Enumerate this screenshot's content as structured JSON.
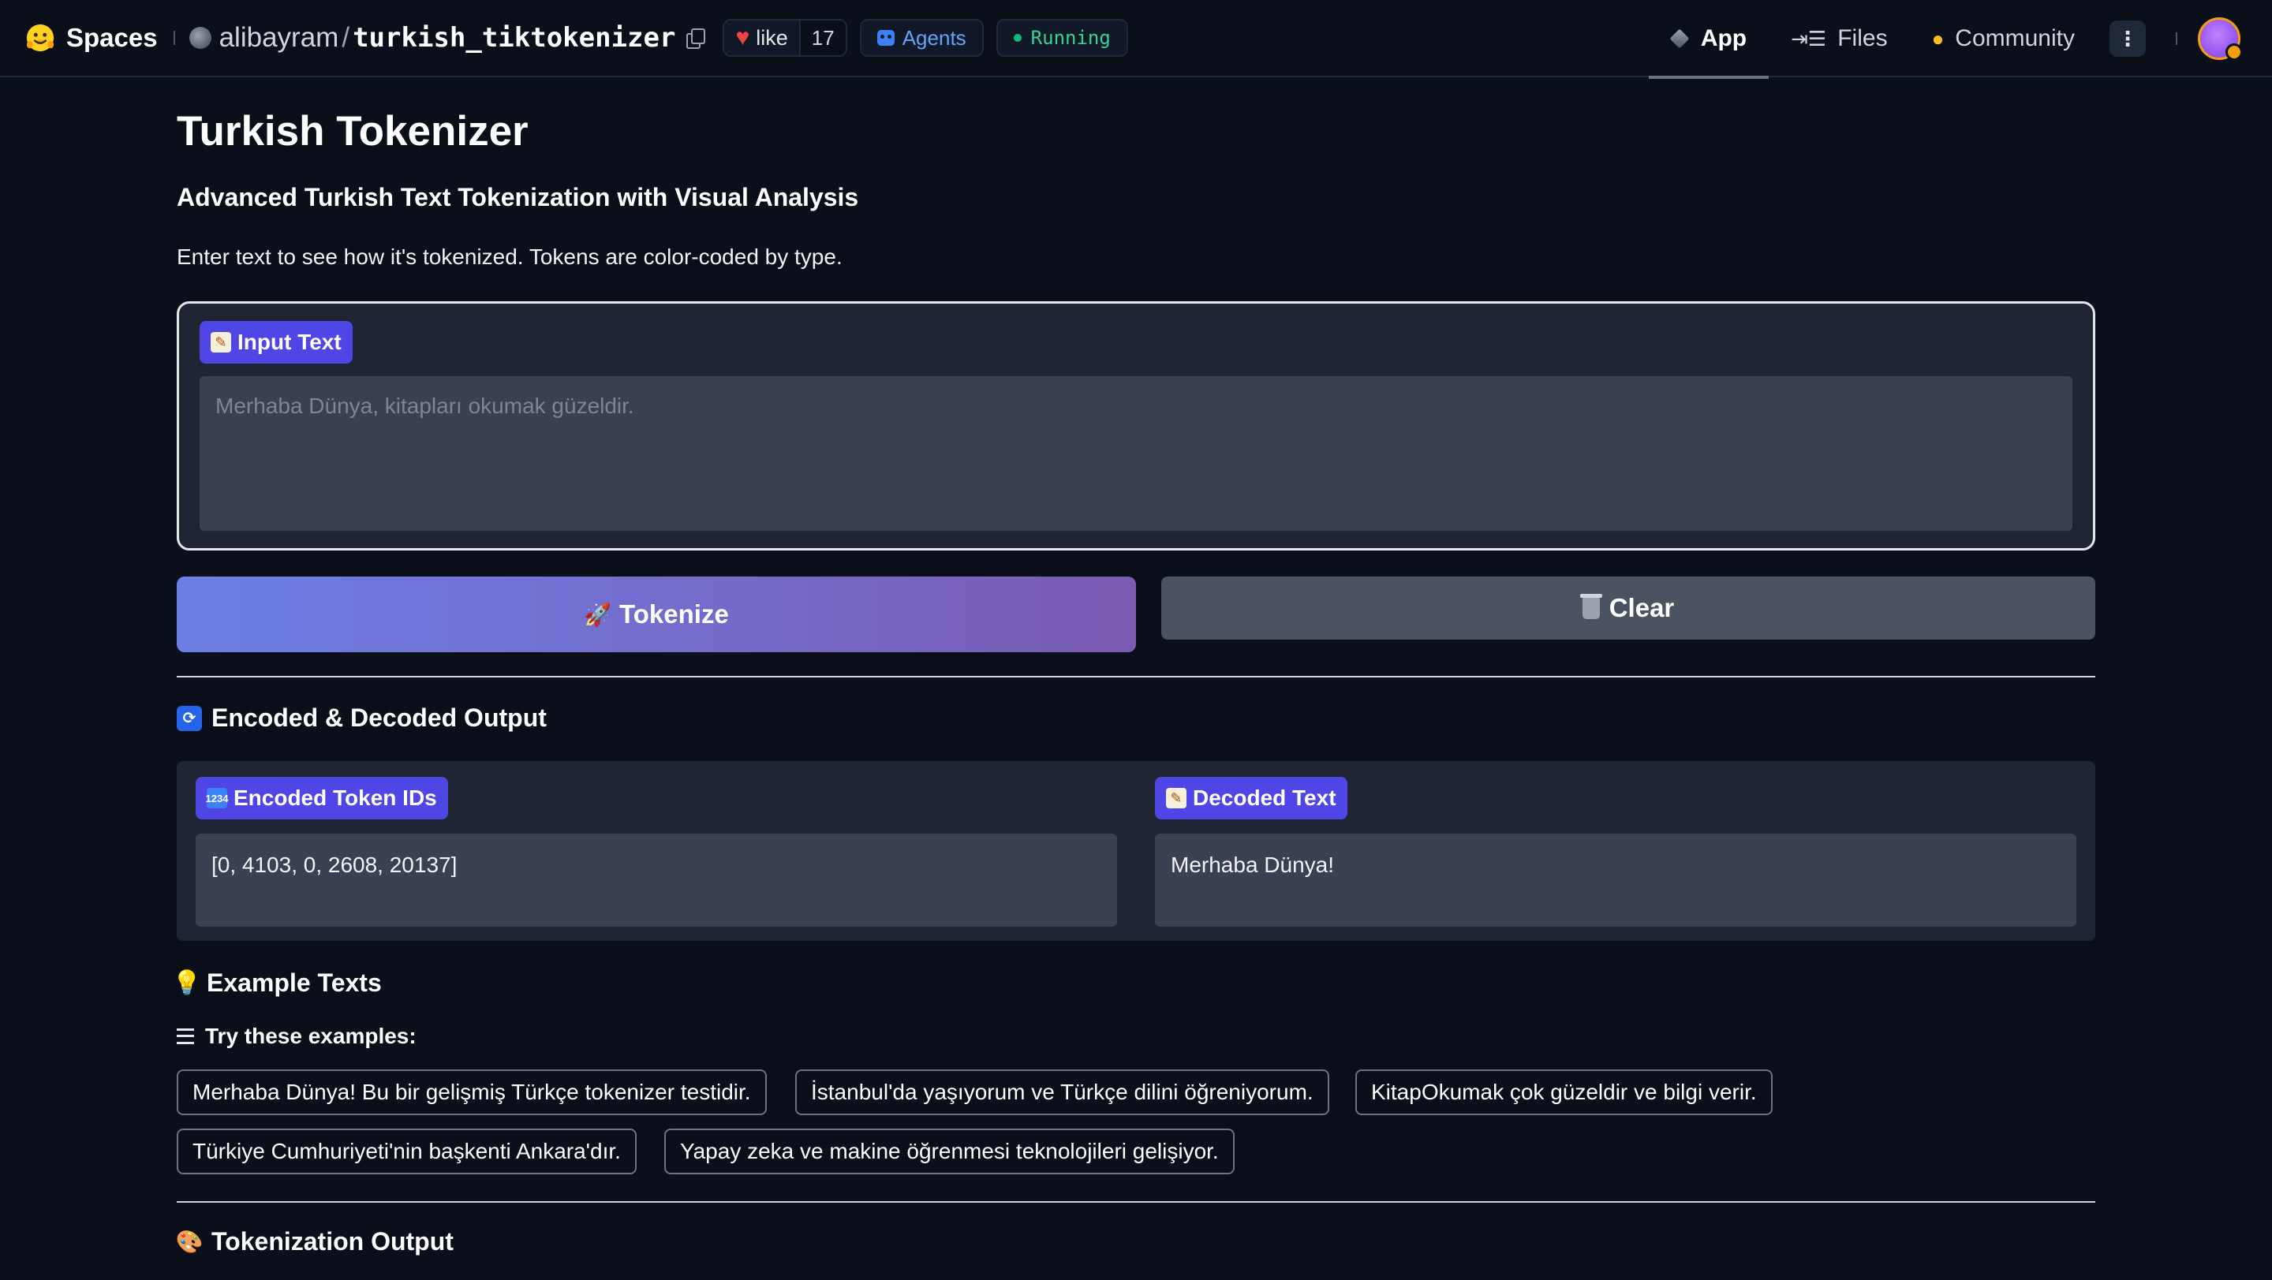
{
  "topbar": {
    "brand": "Spaces",
    "owner": "alibayram",
    "slash": "/",
    "repo": "turkish_tiktokenizer",
    "like_label": "like",
    "like_count": "17",
    "agents_label": "Agents",
    "status_label": "Running",
    "tabs": [
      {
        "label": "App",
        "icon": "cube-icon",
        "active": true
      },
      {
        "label": "Files",
        "icon": "files-icon",
        "active": false
      },
      {
        "label": "Community",
        "icon": "community-icon",
        "active": false
      }
    ]
  },
  "page": {
    "title": "Turkish Tokenizer",
    "subtitle": "Advanced Turkish Text Tokenization with Visual Analysis",
    "description": "Enter text to see how it's tokenized. Tokens are color-coded by type."
  },
  "input": {
    "label": "Input Text",
    "placeholder": "Merhaba Dünya, kitapları okumak güzeldir."
  },
  "buttons": {
    "tokenize": "Tokenize",
    "clear": "Clear"
  },
  "output": {
    "section_title": "Encoded & Decoded Output",
    "encoded_label": "Encoded Token IDs",
    "encoded_value": "[0, 4103, 0, 2608, 20137]",
    "decoded_label": "Decoded Text",
    "decoded_value": "Merhaba Dünya!"
  },
  "examples": {
    "section_title": "Example Texts",
    "label": "Try these examples:",
    "items": [
      "Merhaba Dünya! Bu bir gelişmiş Türkçe tokenizer testidir.",
      "İstanbul'da yaşıyorum ve Türkçe dilini öğreniyorum.",
      "KitapOkumak çok güzeldir ve bilgi verir.",
      "Türkiye Cumhuriyeti'nin başkenti Ankara'dır.",
      "Yapay zeka ve makine öğrenmesi teknolojileri gelişiyor."
    ]
  },
  "tokenization": {
    "section_title": "Tokenization Output"
  },
  "colors": {
    "background": "#0b0f19",
    "chip": "#4f46e5",
    "tokenize_gradient_start": "#6d7fe6",
    "tokenize_gradient_end": "#7a5bb3",
    "clear_button": "#4b5260",
    "status_running": "#34d399",
    "agents": "#60a5fa"
  }
}
